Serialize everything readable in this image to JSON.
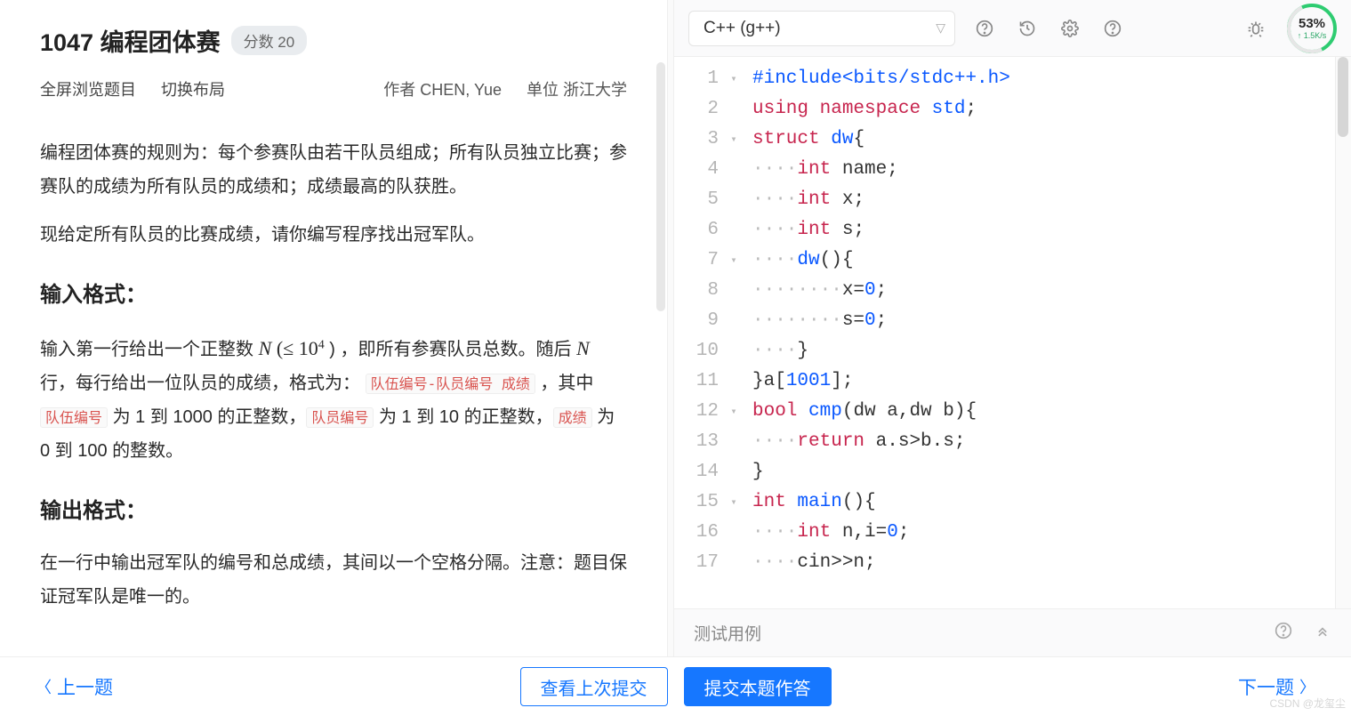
{
  "problem": {
    "title": "1047 编程团体赛",
    "score_badge": "分数 20",
    "link_fullscreen": "全屏浏览题目",
    "link_layout": "切换布局",
    "author_label": "作者 CHEN, Yue",
    "affiliation_label": "单位 浙江大学",
    "para1": "编程团体赛的规则为：每个参赛队由若干队员组成；所有队员独立比赛；参赛队的成绩为所有队员的成绩和；成绩最高的队获胜。",
    "para2": "现给定所有队员的比赛成绩，请你编写程序找出冠军队。",
    "h_input": "输入格式：",
    "input_a": "输入第一行给出一个正整数 ",
    "input_N": "N",
    "input_leq": " (≤ 10",
    "input_exp": "4",
    "input_b": ")  ，即所有参赛队员总数。随后 ",
    "input_c": " 行，每行给出一位队员的成绩，格式为： ",
    "tag_team_member": "队伍编号-队员编号 成绩",
    "input_d": "，其中 ",
    "tag_team": "队伍编号",
    "input_e": " 为 1 到 1000 的正整数，",
    "tag_member": "队员编号",
    "input_f": " 为 1 到 10 的正整数，",
    "tag_score": "成绩",
    "input_g": " 为 0 到 100 的整数。",
    "h_output": "输出格式：",
    "output_p": "在一行中输出冠军队的编号和总成绩，其间以一个空格分隔。注意：题目保证冠军队是唯一的。"
  },
  "editor": {
    "lang": "C++ (g++)",
    "dial_pct": "53%",
    "dial_rate": "↑ 1.5K/s",
    "lines": [
      {
        "n": "1",
        "fold": "▾",
        "segs": [
          {
            "t": "#include",
            "c": "kw-pre"
          },
          {
            "t": "<bits/stdc++.h>",
            "c": "kw-incname"
          }
        ]
      },
      {
        "n": "2",
        "fold": "",
        "segs": [
          {
            "t": "using",
            "c": "kw-red"
          },
          {
            "t": " "
          },
          {
            "t": "namespace",
            "c": "kw-red"
          },
          {
            "t": " "
          },
          {
            "t": "std",
            "c": "kw-blue"
          },
          {
            "t": ";"
          }
        ]
      },
      {
        "n": "3",
        "fold": "▾",
        "segs": [
          {
            "t": "struct",
            "c": "kw-red"
          },
          {
            "t": " "
          },
          {
            "t": "dw",
            "c": "kw-blue"
          },
          {
            "t": "{"
          }
        ]
      },
      {
        "n": "4",
        "fold": "",
        "segs": [
          {
            "t": "····",
            "c": "dot"
          },
          {
            "t": "int",
            "c": "kw-red"
          },
          {
            "t": " name;"
          }
        ]
      },
      {
        "n": "5",
        "fold": "",
        "segs": [
          {
            "t": "····",
            "c": "dot"
          },
          {
            "t": "int",
            "c": "kw-red"
          },
          {
            "t": " x;"
          }
        ]
      },
      {
        "n": "6",
        "fold": "",
        "segs": [
          {
            "t": "····",
            "c": "dot"
          },
          {
            "t": "int",
            "c": "kw-red"
          },
          {
            "t": " s;"
          }
        ]
      },
      {
        "n": "7",
        "fold": "▾",
        "segs": [
          {
            "t": "····",
            "c": "dot"
          },
          {
            "t": "dw",
            "c": "kw-fn"
          },
          {
            "t": "(){"
          }
        ]
      },
      {
        "n": "8",
        "fold": "",
        "segs": [
          {
            "t": "········",
            "c": "dot"
          },
          {
            "t": "x="
          },
          {
            "t": "0",
            "c": "num"
          },
          {
            "t": ";"
          }
        ]
      },
      {
        "n": "9",
        "fold": "",
        "segs": [
          {
            "t": "········",
            "c": "dot"
          },
          {
            "t": "s="
          },
          {
            "t": "0",
            "c": "num"
          },
          {
            "t": ";"
          }
        ]
      },
      {
        "n": "10",
        "fold": "",
        "segs": [
          {
            "t": "····",
            "c": "dot"
          },
          {
            "t": "}"
          }
        ]
      },
      {
        "n": "11",
        "fold": "",
        "segs": [
          {
            "t": "}a["
          },
          {
            "t": "1001",
            "c": "num"
          },
          {
            "t": "];"
          }
        ]
      },
      {
        "n": "12",
        "fold": "▾",
        "segs": [
          {
            "t": "bool",
            "c": "kw-red"
          },
          {
            "t": " "
          },
          {
            "t": "cmp",
            "c": "kw-fn"
          },
          {
            "t": "(dw a,dw b){"
          }
        ]
      },
      {
        "n": "13",
        "fold": "",
        "segs": [
          {
            "t": "····",
            "c": "dot"
          },
          {
            "t": "return",
            "c": "kw-red"
          },
          {
            "t": " a.s>b.s;"
          }
        ]
      },
      {
        "n": "14",
        "fold": "",
        "segs": [
          {
            "t": "}"
          }
        ]
      },
      {
        "n": "15",
        "fold": "▾",
        "segs": [
          {
            "t": "int",
            "c": "kw-red"
          },
          {
            "t": " "
          },
          {
            "t": "main",
            "c": "kw-fn"
          },
          {
            "t": "(){"
          }
        ]
      },
      {
        "n": "16",
        "fold": "",
        "segs": [
          {
            "t": "····",
            "c": "dot"
          },
          {
            "t": "int",
            "c": "kw-red"
          },
          {
            "t": " n,i="
          },
          {
            "t": "0",
            "c": "num"
          },
          {
            "t": ";"
          }
        ]
      },
      {
        "n": "17",
        "fold": "",
        "segs": [
          {
            "t": "····",
            "c": "dot"
          },
          {
            "t": "cin>>n;"
          }
        ]
      }
    ],
    "tests_label": "测试用例"
  },
  "bottom": {
    "prev": "上一题",
    "view_last": "查看上次提交",
    "submit": "提交本题作答",
    "next": "下一题"
  },
  "watermark": "CSDN @龙玺尘"
}
